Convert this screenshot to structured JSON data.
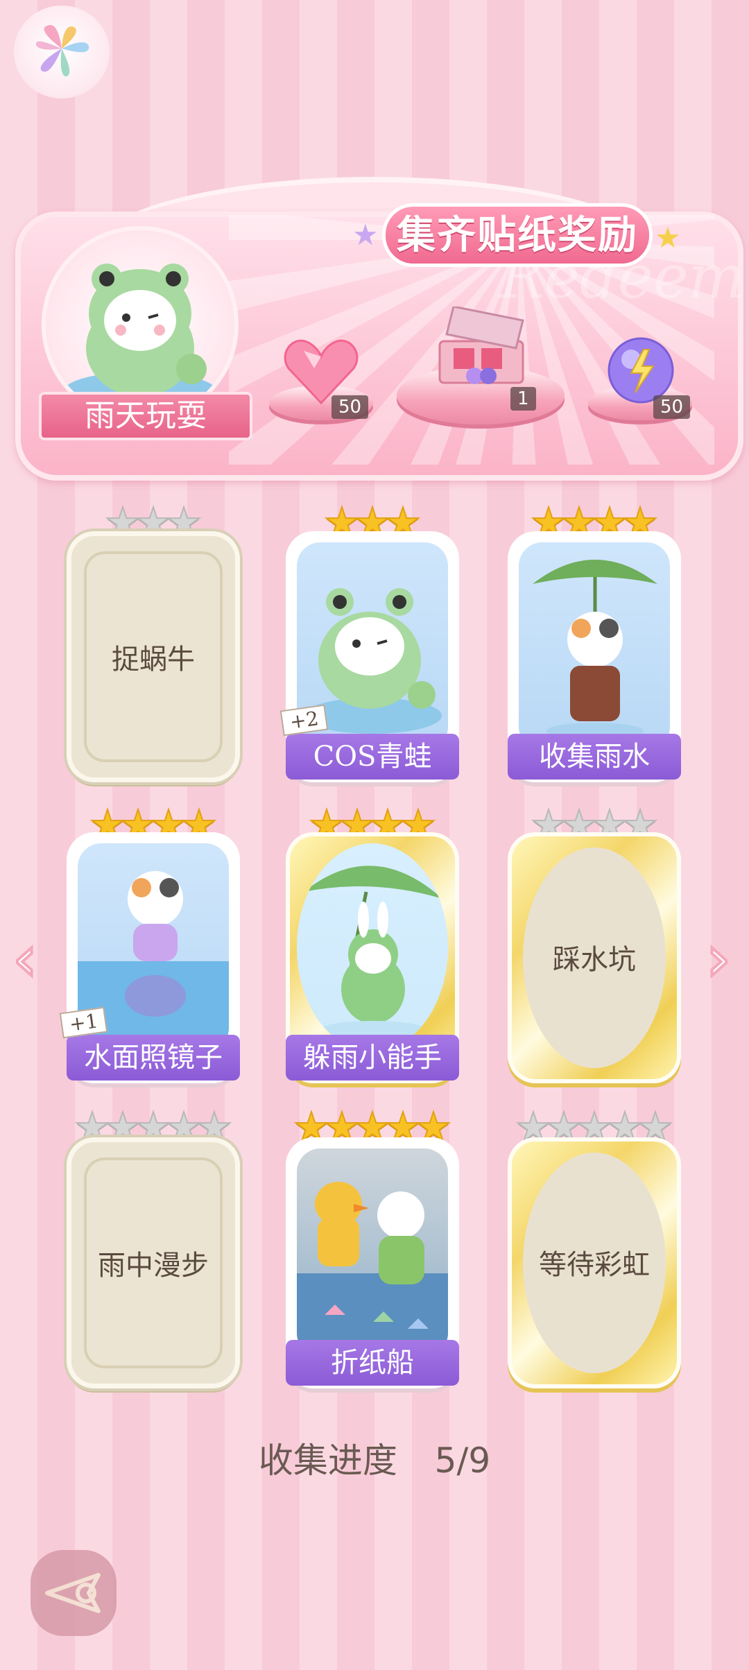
{
  "banner": {
    "title": "集齐贴纸奖励",
    "watermark": "Redeem",
    "theme_label": "雨天玩耍",
    "rewards": [
      {
        "icon": "heart-gem-icon",
        "count": "50"
      },
      {
        "icon": "gift-box-icon",
        "count": "1"
      },
      {
        "icon": "energy-orb-icon",
        "count": "50"
      }
    ]
  },
  "cards": [
    {
      "name": "捉蜗牛",
      "stars": 3,
      "collected": false,
      "style": "beige"
    },
    {
      "name": "COS青蛙",
      "stars": 3,
      "collected": true,
      "style": "blue",
      "badge": "+2"
    },
    {
      "name": "收集雨水",
      "stars": 4,
      "collected": true,
      "style": "blue"
    },
    {
      "name": "水面照镜子",
      "stars": 4,
      "collected": true,
      "style": "blue",
      "badge": "+1"
    },
    {
      "name": "躲雨小能手",
      "stars": 4,
      "collected": true,
      "style": "gold"
    },
    {
      "name": "踩水坑",
      "stars": 4,
      "collected": false,
      "style": "gold"
    },
    {
      "name": "雨中漫步",
      "stars": 5,
      "collected": false,
      "style": "beige"
    },
    {
      "name": "折纸船",
      "stars": 5,
      "collected": true,
      "style": "blue"
    },
    {
      "name": "等待彩虹",
      "stars": 5,
      "collected": false,
      "style": "gold"
    }
  ],
  "progress": {
    "label": "收集进度",
    "value": "5/9"
  },
  "nav": {
    "prev": "‹",
    "next": "›"
  },
  "colors": {
    "accent": "#8b5bd6",
    "gold": "#f8c225",
    "pink": "#f06a90"
  }
}
